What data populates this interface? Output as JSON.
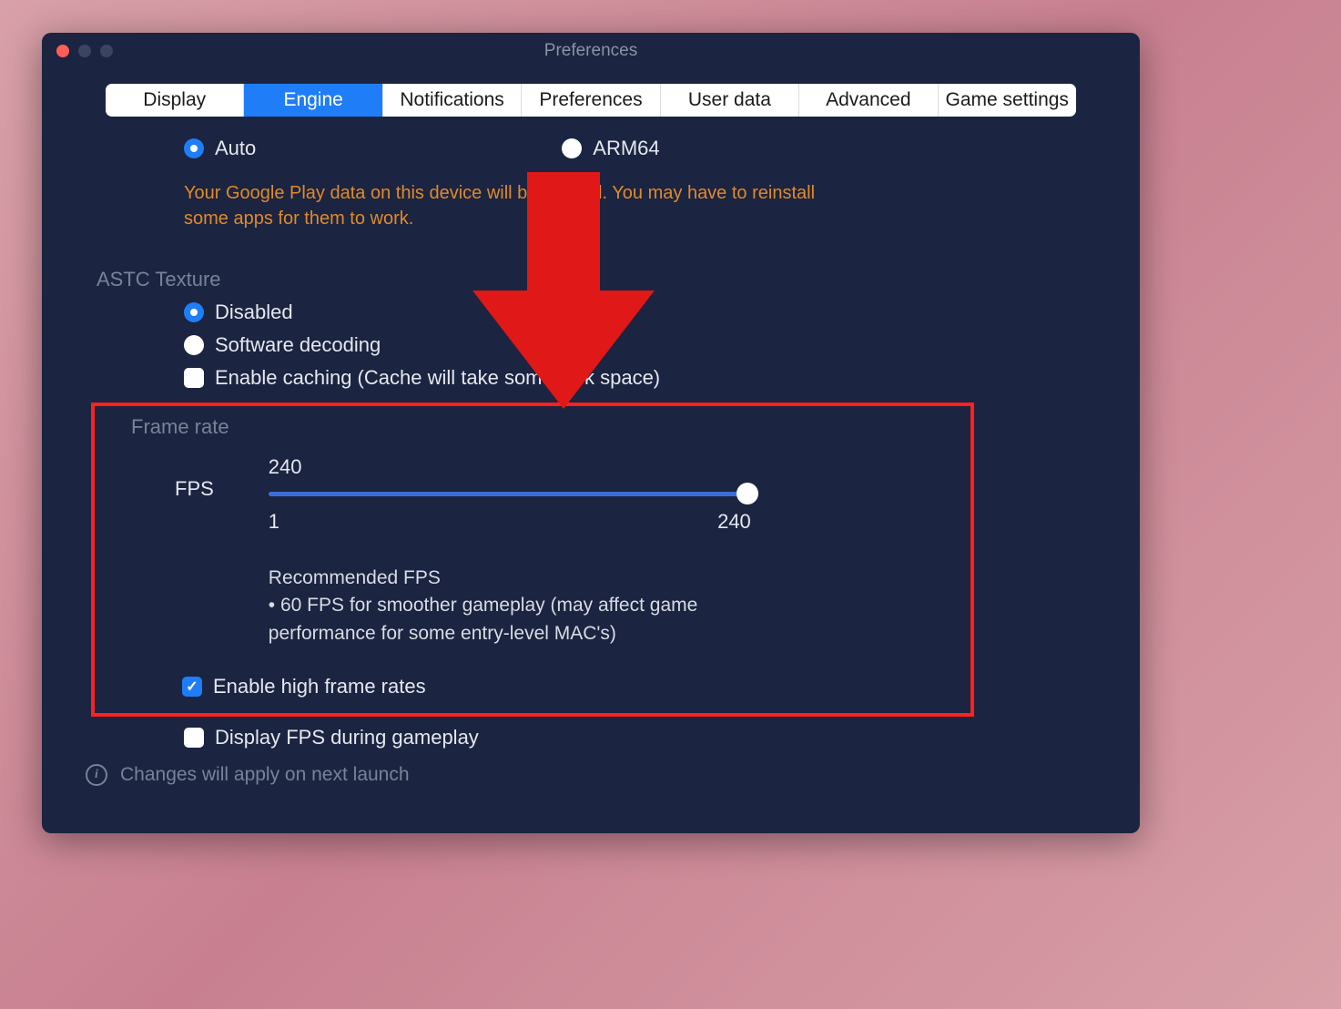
{
  "window": {
    "title": "Preferences"
  },
  "tabs": [
    {
      "label": "Display",
      "active": false
    },
    {
      "label": "Engine",
      "active": true
    },
    {
      "label": "Notifications",
      "active": false
    },
    {
      "label": "Preferences",
      "active": false
    },
    {
      "label": "User data",
      "active": false
    },
    {
      "label": "Advanced",
      "active": false
    },
    {
      "label": "Game settings",
      "active": false
    }
  ],
  "arch": {
    "auto": "Auto",
    "arm64": "ARM64",
    "warning_line1": "Your Google Play data on this device will be cleared. You may have to reinstall",
    "warning_line2": "some apps for them to work."
  },
  "astc": {
    "section": "ASTC Texture",
    "disabled": "Disabled",
    "software": "Software decoding",
    "enable_caching": "Enable caching (Cache will take some disk space)"
  },
  "framerate": {
    "section": "Frame rate",
    "fps_label": "FPS",
    "value": "240",
    "min": "1",
    "max": "240",
    "recommended_title": "Recommended FPS",
    "recommended_bullet": "• 60 FPS for smoother gameplay (may affect game performance for some entry-level MAC's)",
    "enable_high": "Enable high frame rates"
  },
  "display_fps": "Display FPS during gameplay",
  "footer": {
    "info": "Changes will apply on next launch"
  },
  "annotation": {
    "arrow_color": "#e01818"
  }
}
